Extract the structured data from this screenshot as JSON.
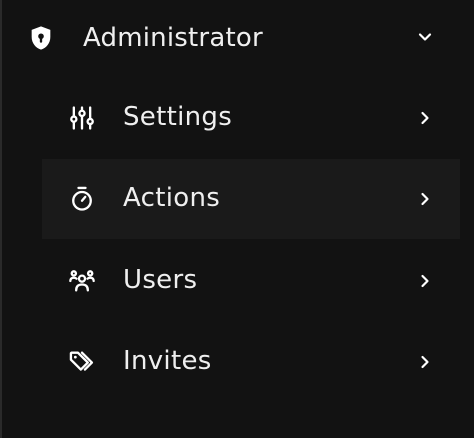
{
  "colors": {
    "background": "#121212",
    "active_row": "#1a1a1a",
    "text": "#efefef",
    "border": "#2a2a2a"
  },
  "menu": {
    "header": {
      "label": "Administrator",
      "icon": "shield-lock-icon",
      "expanded": true,
      "chevron": "chevron-down-icon"
    },
    "items": [
      {
        "label": "Settings",
        "icon": "sliders-icon",
        "chevron": "chevron-right-icon",
        "active": false
      },
      {
        "label": "Actions",
        "icon": "stopwatch-icon",
        "chevron": "chevron-right-icon",
        "active": true
      },
      {
        "label": "Users",
        "icon": "users-group-icon",
        "chevron": "chevron-right-icon",
        "active": false
      },
      {
        "label": "Invites",
        "icon": "tags-icon",
        "chevron": "chevron-right-icon",
        "active": false
      }
    ]
  }
}
